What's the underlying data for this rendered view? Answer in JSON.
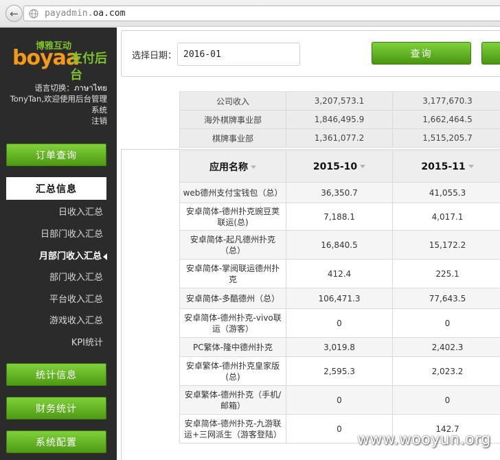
{
  "browser": {
    "url_prefix": "payadmin.",
    "url_domain": "oa.com",
    "back_icon": "arrow-left-icon",
    "site_icon": "globe-icon"
  },
  "sidebar": {
    "logo_sub": "博雅互动",
    "logo_main": "boyaa",
    "logo_tag": "支付后台",
    "lang_switch_label": "语言切换：",
    "lang_option": "ภาษาไทย",
    "welcome": "TonyTan,欢迎使用后台管理系统",
    "logout": "注销",
    "menu": {
      "orders": "订单查询",
      "summary": "汇总信息",
      "stats": "统计信息",
      "finance": "财务统计",
      "config": "系统配置"
    },
    "submenu": [
      "日收入汇总",
      "日部门收入汇总",
      "月部门收入汇总",
      "部门收入汇总",
      "平台收入汇总",
      "游戏收入汇总",
      "KPI统计"
    ]
  },
  "filter": {
    "label": "选择日期：",
    "date_value": "2016-01",
    "query_label": "查询"
  },
  "summary_table": {
    "rows": [
      [
        "公司收入",
        "3,207,573.1",
        "3,177,670.3"
      ],
      [
        "海外棋牌事业部",
        "1,846,495.9",
        "1,662,464.5"
      ],
      [
        "棋牌事业部",
        "1,361,077.2",
        "1,515,205.7"
      ]
    ]
  },
  "app_table": {
    "headers": [
      "应用名称",
      "2015-10",
      "2015-11"
    ],
    "rows": [
      [
        "web德州支付宝钱包（总）",
        "36,350.7",
        "41,055.3"
      ],
      [
        "安卓简体-德州扑克豌豆荚联运(总)",
        "7,188.1",
        "4,017.1"
      ],
      [
        "安卓简体-起凡德州扑克（总）",
        "16,840.5",
        "15,172.2"
      ],
      [
        "安卓简体-掌阅联运德州扑克",
        "412.4",
        "225.1"
      ],
      [
        "安卓简体-多酷德州（总）",
        "106,471.3",
        "77,643.5"
      ],
      [
        "安卓简体-德州扑克-vivo联运（游客）",
        "0",
        "0"
      ],
      [
        "PC繁体-隆中德州扑克",
        "3,019.8",
        "2,402.3"
      ],
      [
        "安卓繁体-德州扑克皇家版(总)",
        "2,595.3",
        "2,023.2"
      ],
      [
        "安卓繁体-德州扑克（手机/邮箱）",
        "0",
        "0"
      ],
      [
        "安卓简体-德州扑克-九游联运+三网派生（游客登陆）",
        "0",
        "142.7"
      ]
    ]
  },
  "watermark": "www.wooyun.org",
  "colors": {
    "sidebar_bg": "#2b2b2b",
    "button_green": "#5fb320",
    "logo_orange": "#f39b19",
    "logo_green": "#7cc12a"
  }
}
